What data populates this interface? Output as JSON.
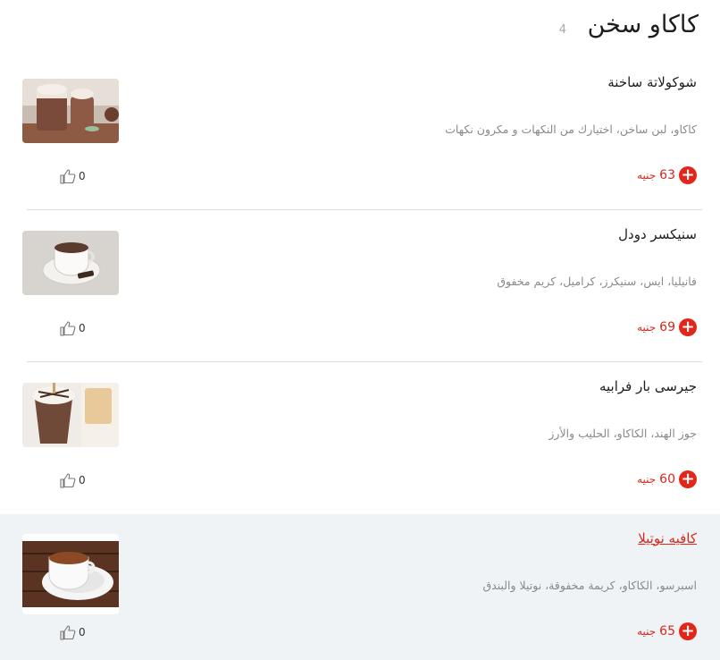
{
  "section": {
    "title": "كاكاو سخن",
    "count": "4"
  },
  "currency": "جنيه",
  "items": [
    {
      "name": "شوكولاتة ساخنة",
      "description": "كاكاو، لبن ساخن، اختيارك من النكهات و مكرون نكهات",
      "price": "63",
      "likes": "0",
      "image_icon": "hot-chocolate-mason-jar"
    },
    {
      "name": "سنيكسر دودل",
      "description": "فانيليا، ايس، سنيكرز، كراميل، كريم مخفوق",
      "price": "69",
      "likes": "0",
      "image_icon": "cocoa-cup-saucer"
    },
    {
      "name": "جيرسى بار فرابيه",
      "description": "جوز الهند، الكاكاو، الحليب والأرز",
      "price": "60",
      "likes": "0",
      "image_icon": "frappe-glass"
    },
    {
      "name": "كافيه نوتيلا",
      "description": "اسبرسو، الكاكاو، كريمة مخفوقة، نوتيلا والبندق",
      "price": "65",
      "likes": "0",
      "image_icon": "coffee-cup-wood-table"
    }
  ],
  "colors": {
    "accent": "#e2261a",
    "highlight_bg": "#f0f3f6"
  }
}
